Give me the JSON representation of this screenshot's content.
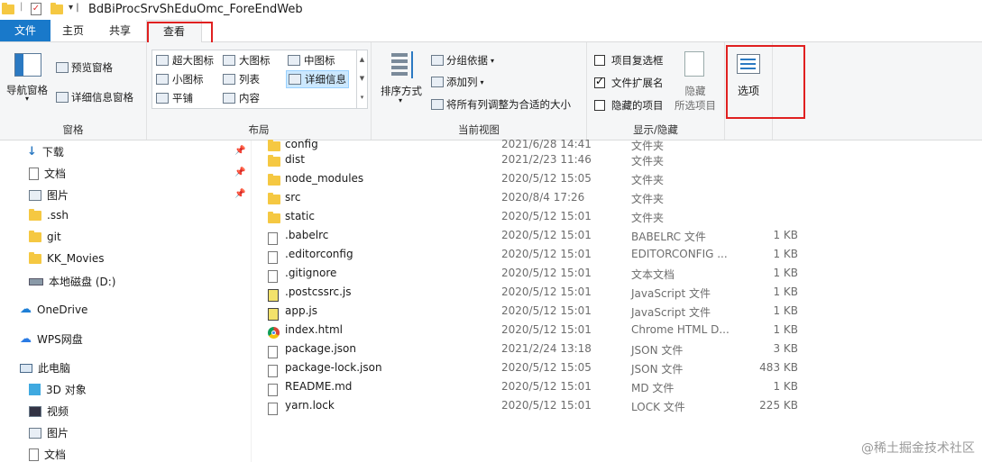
{
  "window": {
    "title": "BdBiProcSrvShEduOmc_ForeEndWeb"
  },
  "menu": {
    "file": "文件",
    "home": "主页",
    "share": "共享",
    "view": "查看"
  },
  "ribbon": {
    "panes": {
      "nav_pane": "导航窗格",
      "preview_pane": "预览窗格",
      "details_pane": "详细信息窗格",
      "group_label": "窗格"
    },
    "layout": {
      "items": [
        "超大图标",
        "大图标",
        "中图标",
        "小图标",
        "列表",
        "详细信息",
        "平铺",
        "内容"
      ],
      "selected": "详细信息",
      "group_label": "布局"
    },
    "current_view": {
      "sort": "排序方式",
      "group_by": "分组依据",
      "add_column": "添加列",
      "fit_columns": "将所有列调整为合适的大小",
      "group_label": "当前视图"
    },
    "show_hide": {
      "item_checkboxes": "项目复选框",
      "item_checkboxes_checked": false,
      "file_ext": "文件扩展名",
      "file_ext_checked": true,
      "hidden_items": "隐藏的项目",
      "hidden_items_checked": false,
      "hide_selected": "隐藏",
      "hide_selected_sub": "所选项目",
      "group_label": "显示/隐藏"
    },
    "options": {
      "label": "选项"
    }
  },
  "nav": {
    "items": [
      {
        "label": "下载",
        "icon": "download-icon",
        "pinned": true
      },
      {
        "label": "文档",
        "icon": "document-icon",
        "pinned": true
      },
      {
        "label": "图片",
        "icon": "picture-icon",
        "pinned": true
      },
      {
        "label": ".ssh",
        "icon": "folder-icon"
      },
      {
        "label": "git",
        "icon": "folder-icon"
      },
      {
        "label": "KK_Movies",
        "icon": "folder-icon"
      },
      {
        "label": "本地磁盘 (D:)",
        "icon": "drive-icon"
      },
      {
        "label": "OneDrive",
        "icon": "cloud-icon"
      },
      {
        "label": "WPS网盘",
        "icon": "wps-cloud-icon"
      },
      {
        "label": "此电脑",
        "icon": "computer-icon"
      },
      {
        "label": "3D 对象",
        "icon": "3d-objects-icon"
      },
      {
        "label": "视频",
        "icon": "video-icon"
      },
      {
        "label": "图片",
        "icon": "picture-icon"
      },
      {
        "label": "文档",
        "icon": "document-icon"
      }
    ]
  },
  "files": [
    {
      "name": "config",
      "date": "2021/6/28 14:41",
      "type": "文件夹",
      "size": "",
      "icon": "folder"
    },
    {
      "name": "dist",
      "date": "2021/2/23 11:46",
      "type": "文件夹",
      "size": "",
      "icon": "folder"
    },
    {
      "name": "node_modules",
      "date": "2020/5/12 15:05",
      "type": "文件夹",
      "size": "",
      "icon": "folder"
    },
    {
      "name": "src",
      "date": "2020/8/4 17:26",
      "type": "文件夹",
      "size": "",
      "icon": "folder"
    },
    {
      "name": "static",
      "date": "2020/5/12 15:01",
      "type": "文件夹",
      "size": "",
      "icon": "folder"
    },
    {
      "name": ".babelrc",
      "date": "2020/5/12 15:01",
      "type": "BABELRC 文件",
      "size": "1 KB",
      "icon": "doc"
    },
    {
      "name": ".editorconfig",
      "date": "2020/5/12 15:01",
      "type": "EDITORCONFIG ...",
      "size": "1 KB",
      "icon": "doc"
    },
    {
      "name": ".gitignore",
      "date": "2020/5/12 15:01",
      "type": "文本文档",
      "size": "1 KB",
      "icon": "doc"
    },
    {
      "name": ".postcssrc.js",
      "date": "2020/5/12 15:01",
      "type": "JavaScript 文件",
      "size": "1 KB",
      "icon": "js"
    },
    {
      "name": "app.js",
      "date": "2020/5/12 15:01",
      "type": "JavaScript 文件",
      "size": "1 KB",
      "icon": "js"
    },
    {
      "name": "index.html",
      "date": "2020/5/12 15:01",
      "type": "Chrome HTML D...",
      "size": "1 KB",
      "icon": "chrome"
    },
    {
      "name": "package.json",
      "date": "2021/2/24 13:18",
      "type": "JSON 文件",
      "size": "3 KB",
      "icon": "doc"
    },
    {
      "name": "package-lock.json",
      "date": "2020/5/12 15:05",
      "type": "JSON 文件",
      "size": "483 KB",
      "icon": "doc"
    },
    {
      "name": "README.md",
      "date": "2020/5/12 15:01",
      "type": "MD 文件",
      "size": "1 KB",
      "icon": "doc"
    },
    {
      "name": "yarn.lock",
      "date": "2020/5/12 15:01",
      "type": "LOCK 文件",
      "size": "225 KB",
      "icon": "doc"
    }
  ],
  "watermark": "@稀土掘金技术社区",
  "colors": {
    "accent": "#1979ca",
    "highlight_box": "#e02020",
    "selected": "#cce8ff"
  }
}
